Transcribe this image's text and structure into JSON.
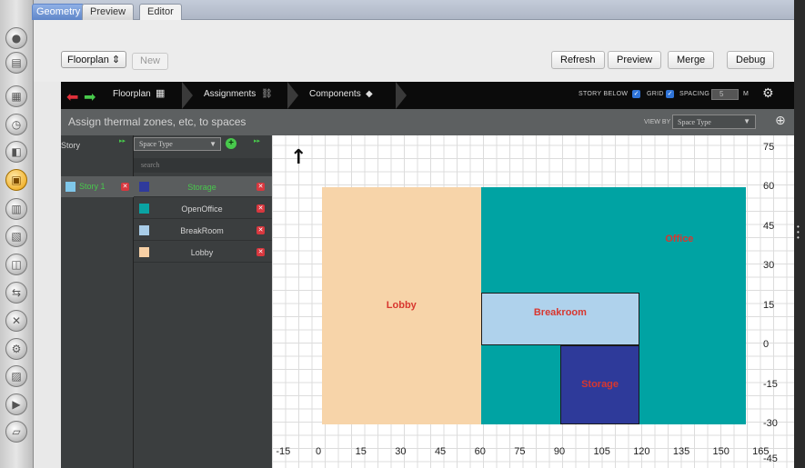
{
  "tabs": [
    {
      "label": "Geometry"
    },
    {
      "label": "Preview"
    },
    {
      "label": "Editor"
    }
  ],
  "toolbar": {
    "mode_select": "Floorplan",
    "new_label": "New",
    "refresh_label": "Refresh",
    "preview_label": "Preview",
    "merge_label": "Merge",
    "debug_label": "Debug"
  },
  "nav": {
    "crumb_floorplan": "Floorplan",
    "crumb_assignments": "Assignments",
    "crumb_components": "Components",
    "story_below": "STORY BELOW",
    "grid": "GRID",
    "spacing": "SPACING",
    "spacing_value": "5",
    "spacing_unit": "M"
  },
  "subbar": {
    "title": "Assign thermal zones, etc, to spaces",
    "view_by_label": "VIEW BY",
    "view_by_value": "Space Type"
  },
  "story_panel": {
    "header": "Story",
    "stories": [
      {
        "name": "Story 1",
        "color": "#7fc7ea"
      }
    ]
  },
  "space_panel": {
    "dropdown": "Space Type",
    "search_placeholder": "search",
    "items": [
      {
        "label": "Storage",
        "color": "#2f3a9c",
        "selected": true
      },
      {
        "label": "OpenOffice",
        "color": "#0aa3a3",
        "selected": false
      },
      {
        "label": "BreakRoom",
        "color": "#a9cde8",
        "selected": false
      },
      {
        "label": "Lobby",
        "color": "#f7d0a5",
        "selected": false
      }
    ]
  },
  "canvas": {
    "rooms": [
      {
        "label": "Lobby",
        "color": "#f7d4a9",
        "x1": 0,
        "x2": 60,
        "y1": -30,
        "y2": 60
      },
      {
        "label": "Office",
        "color": "#00a3a3",
        "x1": 60,
        "x2": 160,
        "y1": -30,
        "y2": 60
      },
      {
        "label": "Breakroom",
        "color": "#afd2ec",
        "x1": 60,
        "x2": 120,
        "y1": 0,
        "y2": 20
      },
      {
        "label": "Storage",
        "color": "#2e3a9a",
        "x1": 90,
        "x2": 120,
        "y1": -30,
        "y2": 0
      }
    ],
    "x_ticks": [
      "-15",
      "0",
      "15",
      "30",
      "45",
      "60",
      "75",
      "90",
      "105",
      "120",
      "135",
      "150",
      "165"
    ],
    "y_ticks": [
      "75",
      "60",
      "45",
      "30",
      "15",
      "0",
      "-15",
      "-30",
      "-45"
    ]
  }
}
